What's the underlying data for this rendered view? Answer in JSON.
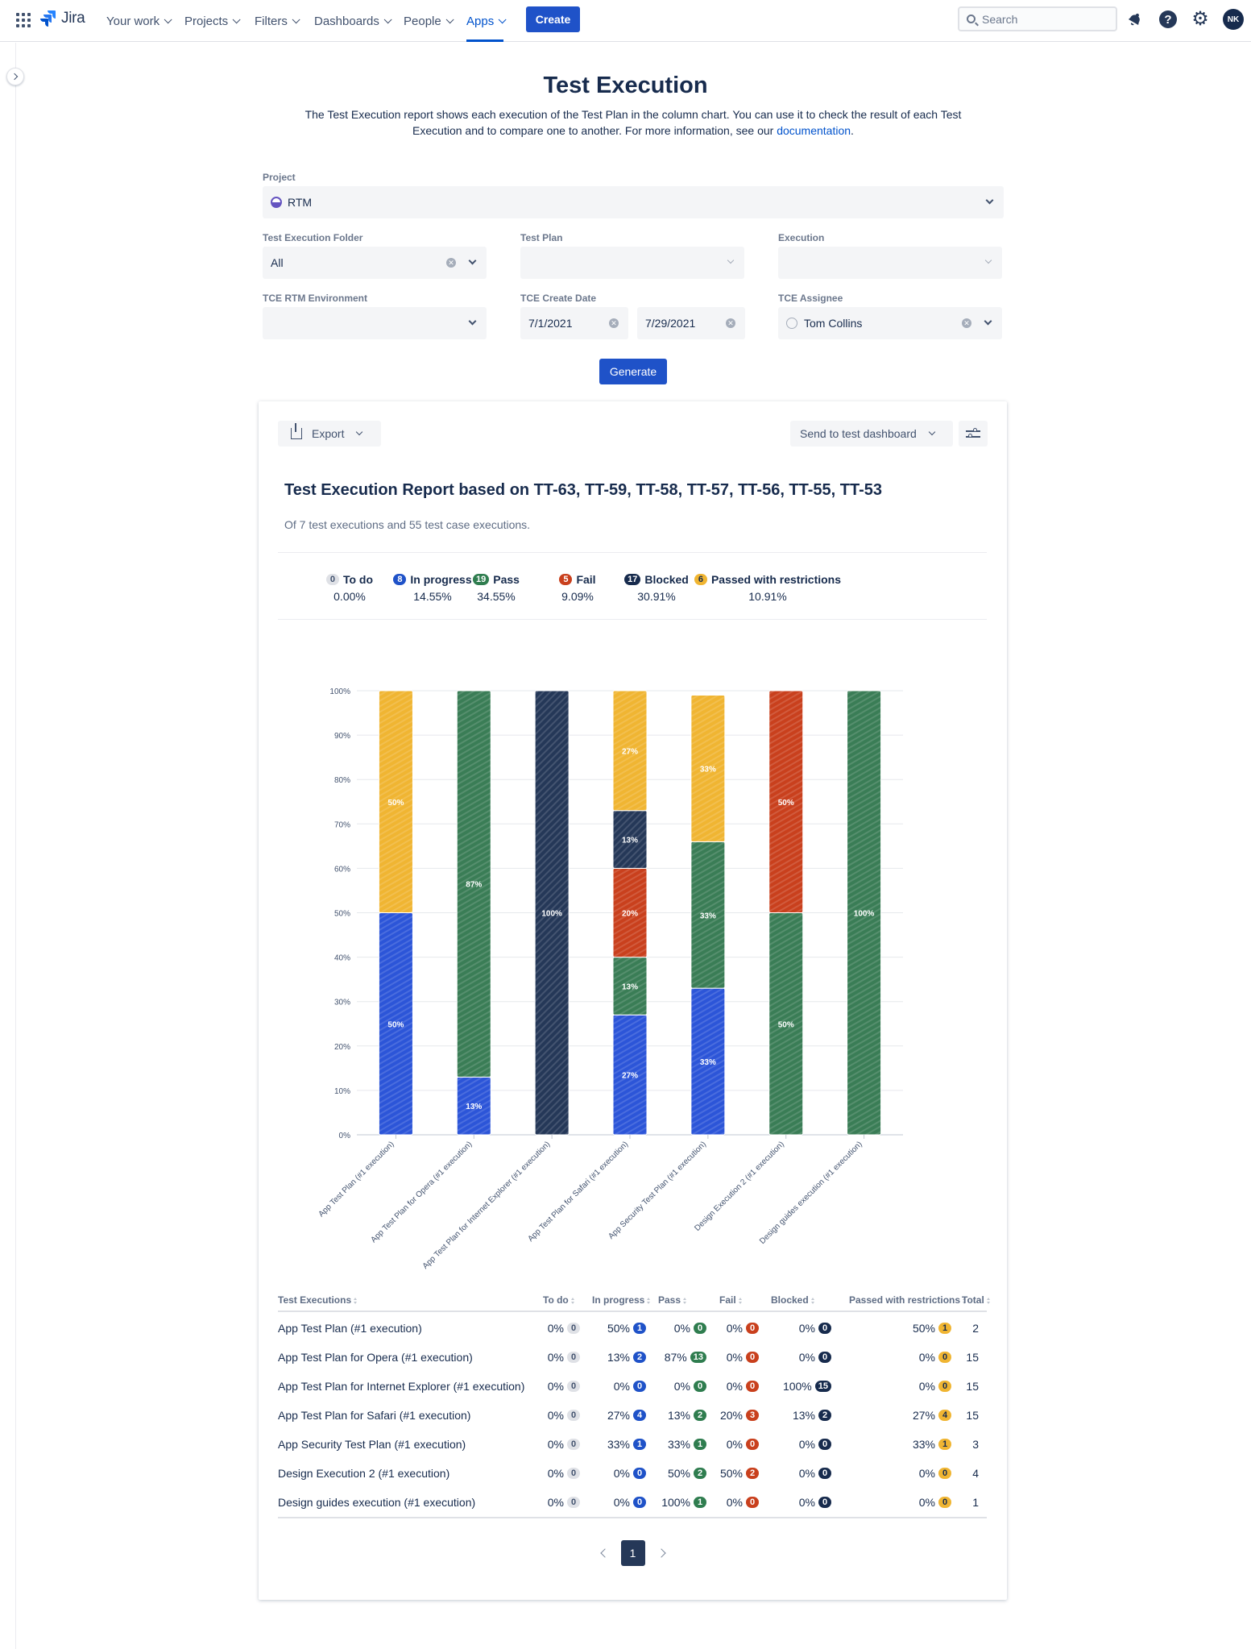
{
  "nav": {
    "product": "Jira",
    "items": [
      {
        "label": "Your work",
        "active": false
      },
      {
        "label": "Projects",
        "active": false
      },
      {
        "label": "Filters",
        "active": false
      },
      {
        "label": "Dashboards",
        "active": false
      },
      {
        "label": "People",
        "active": false
      },
      {
        "label": "Apps",
        "active": true
      }
    ],
    "create_label": "Create",
    "search_placeholder": "Search",
    "help_glyph": "?",
    "user_initials": "NK"
  },
  "header": {
    "title": "Test Execution",
    "desc_text": "The Test Execution report shows each execution of the Test Plan in the column chart. You can use it to check the result of each Test Execution and to compare one to another. For more information, see our ",
    "desc_link": "documentation",
    "desc_end": "."
  },
  "form": {
    "project_label": "Project",
    "project_value": "RTM",
    "folder_label": "Test Execution Folder",
    "folder_value": "All",
    "plan_label": "Test Plan",
    "plan_value": "",
    "execution_label": "Execution",
    "execution_value": "",
    "environment_label": "TCE RTM Environment",
    "environment_value": "",
    "create_date_label": "TCE Create Date",
    "date_from": "7/1/2021",
    "date_to": "7/29/2021",
    "assignee_label": "TCE Assignee",
    "assignee_value": "Tom Collins",
    "generate_label": "Generate"
  },
  "report": {
    "export_label": "Export",
    "dashboard_label": "Send to test dashboard",
    "title": "Test Execution Report based on TT-63, TT-59, TT-58, TT-57, TT-56, TT-55, TT-53",
    "subtitle": "Of 7 test executions and 55 test case executions.",
    "summary": [
      {
        "label": "To do",
        "count": "0",
        "percent": "0.00%",
        "color": "#dfe1e6",
        "text_color": "#42526e"
      },
      {
        "label": "In progress",
        "count": "8",
        "percent": "14.55%",
        "color": "#1f52c8",
        "text_color": "#ffffff"
      },
      {
        "label": "Pass",
        "count": "19",
        "percent": "34.55%",
        "color": "#2f7d4f",
        "text_color": "#ffffff"
      },
      {
        "label": "Fail",
        "count": "5",
        "percent": "9.09%",
        "color": "#c9401d",
        "text_color": "#ffffff"
      },
      {
        "label": "Blocked",
        "count": "17",
        "percent": "30.91%",
        "color": "#172b4d",
        "text_color": "#ffffff"
      },
      {
        "label": "Passed with restrictions",
        "count": "6",
        "percent": "10.91%",
        "color": "#f0b532",
        "text_color": "#172b4d"
      }
    ]
  },
  "chart_data": {
    "type": "bar",
    "stacked": true,
    "ylim": [
      0,
      100
    ],
    "yticks": [
      "0%",
      "10%",
      "20%",
      "30%",
      "40%",
      "50%",
      "60%",
      "70%",
      "80%",
      "90%",
      "100%"
    ],
    "categories": [
      "App Test Plan (#1 execution)",
      "App Test Plan for Opera (#1 execution)",
      "App Test Plan for Internet Explorer (#1 execution)",
      "App Test Plan for Safari (#1 execution)",
      "App Security Test Plan (#1 execution)",
      "Design Execution 2 (#1 execution)",
      "Design guides execution (#1 execution)"
    ],
    "series": [
      {
        "name": "In progress",
        "color": "#2c55d8",
        "values": [
          50,
          13,
          0,
          27,
          33,
          0,
          0
        ]
      },
      {
        "name": "Pass",
        "color": "#3a7d56",
        "values": [
          0,
          87,
          0,
          13,
          33,
          50,
          100
        ]
      },
      {
        "name": "Fail",
        "color": "#c9401d",
        "values": [
          0,
          0,
          0,
          20,
          0,
          50,
          0
        ]
      },
      {
        "name": "Blocked",
        "color": "#253858",
        "values": [
          0,
          0,
          100,
          13,
          0,
          0,
          0
        ]
      },
      {
        "name": "Passed with restrictions",
        "color": "#f0b532",
        "values": [
          50,
          0,
          0,
          27,
          33,
          0,
          0
        ]
      }
    ]
  },
  "table": {
    "headers": [
      "Test Executions",
      "To do",
      "In progress",
      "Pass",
      "Fail",
      "Blocked",
      "Passed with restrictions",
      "Total"
    ],
    "rows": [
      {
        "name": "App Test Plan (#1 execution)",
        "todo": [
          "0%",
          "0"
        ],
        "inprogress": [
          "50%",
          "1"
        ],
        "pass": [
          "0%",
          "0"
        ],
        "fail": [
          "0%",
          "0"
        ],
        "blocked": [
          "0%",
          "0"
        ],
        "pwr": [
          "50%",
          "1"
        ],
        "total": "2"
      },
      {
        "name": "App Test Plan for Opera (#1 execution)",
        "todo": [
          "0%",
          "0"
        ],
        "inprogress": [
          "13%",
          "2"
        ],
        "pass": [
          "87%",
          "13"
        ],
        "fail": [
          "0%",
          "0"
        ],
        "blocked": [
          "0%",
          "0"
        ],
        "pwr": [
          "0%",
          "0"
        ],
        "total": "15"
      },
      {
        "name": "App Test Plan for Internet Explorer (#1 execution)",
        "todo": [
          "0%",
          "0"
        ],
        "inprogress": [
          "0%",
          "0"
        ],
        "pass": [
          "0%",
          "0"
        ],
        "fail": [
          "0%",
          "0"
        ],
        "blocked": [
          "100%",
          "15"
        ],
        "pwr": [
          "0%",
          "0"
        ],
        "total": "15"
      },
      {
        "name": "App Test Plan for Safari (#1 execution)",
        "todo": [
          "0%",
          "0"
        ],
        "inprogress": [
          "27%",
          "4"
        ],
        "pass": [
          "13%",
          "2"
        ],
        "fail": [
          "20%",
          "3"
        ],
        "blocked": [
          "13%",
          "2"
        ],
        "pwr": [
          "27%",
          "4"
        ],
        "total": "15"
      },
      {
        "name": "App Security Test Plan (#1 execution)",
        "todo": [
          "0%",
          "0"
        ],
        "inprogress": [
          "33%",
          "1"
        ],
        "pass": [
          "33%",
          "1"
        ],
        "fail": [
          "0%",
          "0"
        ],
        "blocked": [
          "0%",
          "0"
        ],
        "pwr": [
          "33%",
          "1"
        ],
        "total": "3"
      },
      {
        "name": "Design Execution 2 (#1 execution)",
        "todo": [
          "0%",
          "0"
        ],
        "inprogress": [
          "0%",
          "0"
        ],
        "pass": [
          "50%",
          "2"
        ],
        "fail": [
          "50%",
          "2"
        ],
        "blocked": [
          "0%",
          "0"
        ],
        "pwr": [
          "0%",
          "0"
        ],
        "total": "4"
      },
      {
        "name": "Design guides execution (#1 execution)",
        "todo": [
          "0%",
          "0"
        ],
        "inprogress": [
          "0%",
          "0"
        ],
        "pass": [
          "100%",
          "1"
        ],
        "fail": [
          "0%",
          "0"
        ],
        "blocked": [
          "0%",
          "0"
        ],
        "pwr": [
          "0%",
          "0"
        ],
        "total": "1"
      }
    ],
    "current_page": "1"
  },
  "colors": {
    "accent": "#0052cc",
    "todo": "#dfe1e6",
    "inprogress": "#1f52c8",
    "pass": "#2f7d4f",
    "fail": "#c9401d",
    "blocked": "#172b4d",
    "pwr": "#f0b532"
  }
}
